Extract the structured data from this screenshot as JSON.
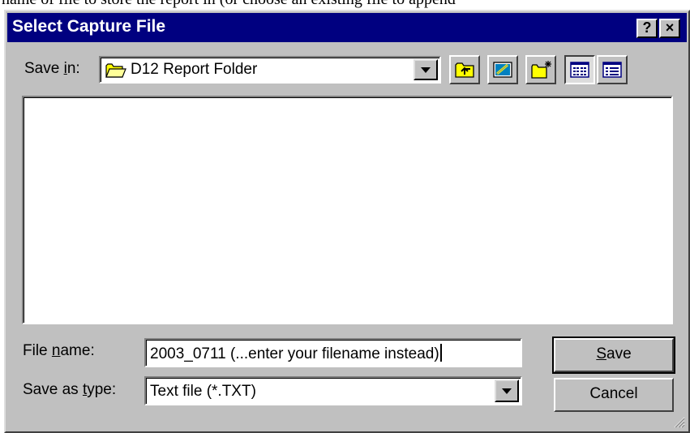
{
  "background_text": "name of file to store the report in (or choose an existing file to append",
  "dialog": {
    "title": "Select Capture File",
    "help_button": "?",
    "close_button": "×"
  },
  "save_in": {
    "label_pre": "Save ",
    "label_key": "i",
    "label_post": "n:",
    "value": "D12 Report Folder"
  },
  "toolbar": {
    "items": [
      "up-one-level",
      "desktop",
      "create-new-folder",
      "list-view",
      "details-view"
    ],
    "active": "list-view"
  },
  "file_name": {
    "label_pre": "File ",
    "label_key": "n",
    "label_post": "ame:",
    "value": "2003_0711  (...enter your filename instead)"
  },
  "save_as_type": {
    "label_pre": "Save as ",
    "label_key": "t",
    "label_post": "ype:",
    "value": "Text file (*.TXT)"
  },
  "buttons": {
    "save_key": "S",
    "save_rest": "ave",
    "cancel": "Cancel"
  },
  "colors": {
    "titlebar": "#000080",
    "face": "#c0c0c0",
    "folder": "#ffff00"
  }
}
